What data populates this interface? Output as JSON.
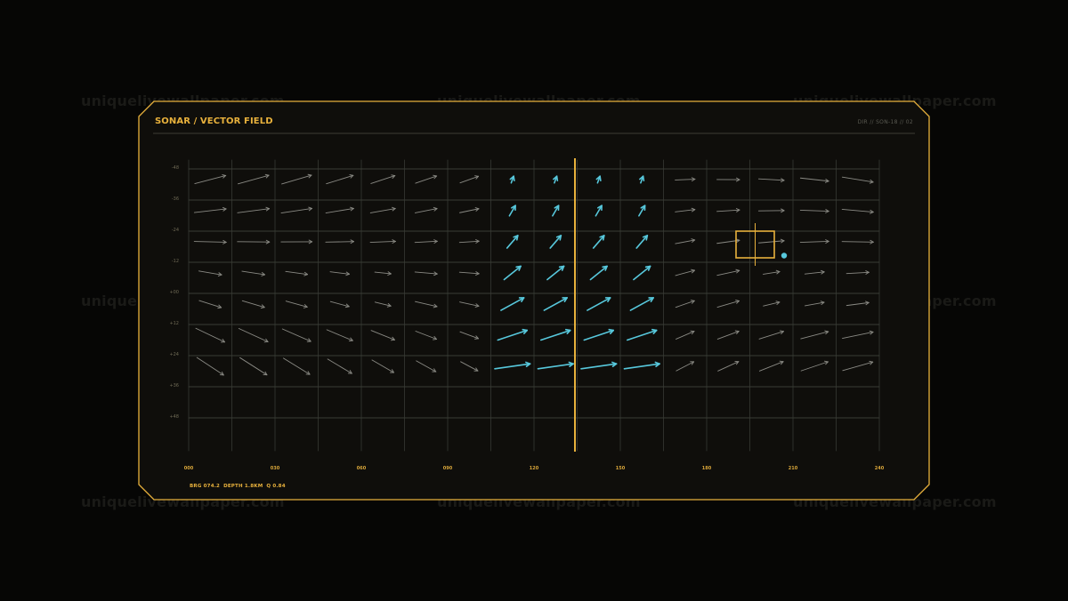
{
  "panel": {
    "title": "SONAR / VECTOR FIELD",
    "code": "DIR // SON-18 // 02"
  },
  "watermark": "uniquelivewallpaper.com",
  "readout": {
    "brg": "BRG 074.2",
    "depth": "DEPTH 1.8KM",
    "q": "Q 0.84"
  },
  "axes": {
    "y_ticks": [
      "-48",
      "-36",
      "-24",
      "-12",
      "+00",
      "+12",
      "+24",
      "+36",
      "+48"
    ],
    "x_ticks": [
      "000",
      "030",
      "060",
      "090",
      "120",
      "150",
      "180",
      "210",
      "240"
    ]
  },
  "colors": {
    "accent": "#e8b13c",
    "highlight": "#57c8dc",
    "vector": "#8a8a84",
    "grid": "#2e302b",
    "panel_bg": "#0f0e0b"
  },
  "icons": {
    "target": "target-box-icon",
    "marker": "dot-marker-icon"
  }
}
